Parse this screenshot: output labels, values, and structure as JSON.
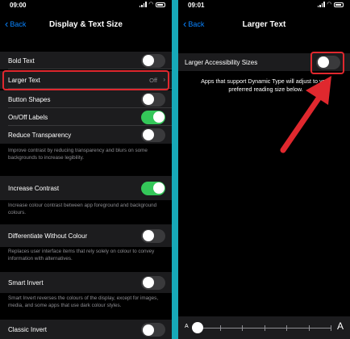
{
  "left": {
    "status": {
      "time": "09:00"
    },
    "nav": {
      "back": "Back",
      "title": "Display & Text Size"
    },
    "rows": {
      "bold_text": {
        "label": "Bold Text",
        "toggle": false
      },
      "larger_text": {
        "label": "Larger Text",
        "value": "Off"
      },
      "button_shapes": {
        "label": "Button Shapes",
        "toggle": false
      },
      "onoff_labels": {
        "label": "On/Off Labels",
        "toggle": true
      },
      "reduce_transparency": {
        "label": "Reduce Transparency",
        "toggle": false,
        "footnote": "Improve contrast by reducing transparency and blurs on some backgrounds to increase legibility."
      },
      "increase_contrast": {
        "label": "Increase Contrast",
        "toggle": true,
        "footnote": "Increase colour contrast between app foreground and background colours."
      },
      "differentiate_colour": {
        "label": "Differentiate Without Colour",
        "toggle": false,
        "footnote": "Replaces user interface items that rely solely on colour to convey information with alternatives."
      },
      "smart_invert": {
        "label": "Smart Invert",
        "toggle": false,
        "footnote": "Smart Invert reverses the colours of the display, except for images, media, and some apps that use dark colour styles."
      },
      "classic_invert": {
        "label": "Classic Invert",
        "toggle": false
      }
    }
  },
  "right": {
    "status": {
      "time": "09:01"
    },
    "nav": {
      "back": "Back",
      "title": "Larger Text"
    },
    "larger_accessibility": {
      "label": "Larger Accessibility Sizes",
      "toggle": false
    },
    "info": "Apps that support Dynamic Type will adjust to your preferred reading size below.",
    "slider": {
      "small_label": "A",
      "large_label": "A",
      "position": 0
    }
  },
  "colors": {
    "accent": "#0a84ff",
    "toggle_on": "#34c759",
    "highlight": "#e0282e",
    "divider": "#17a9b8"
  }
}
